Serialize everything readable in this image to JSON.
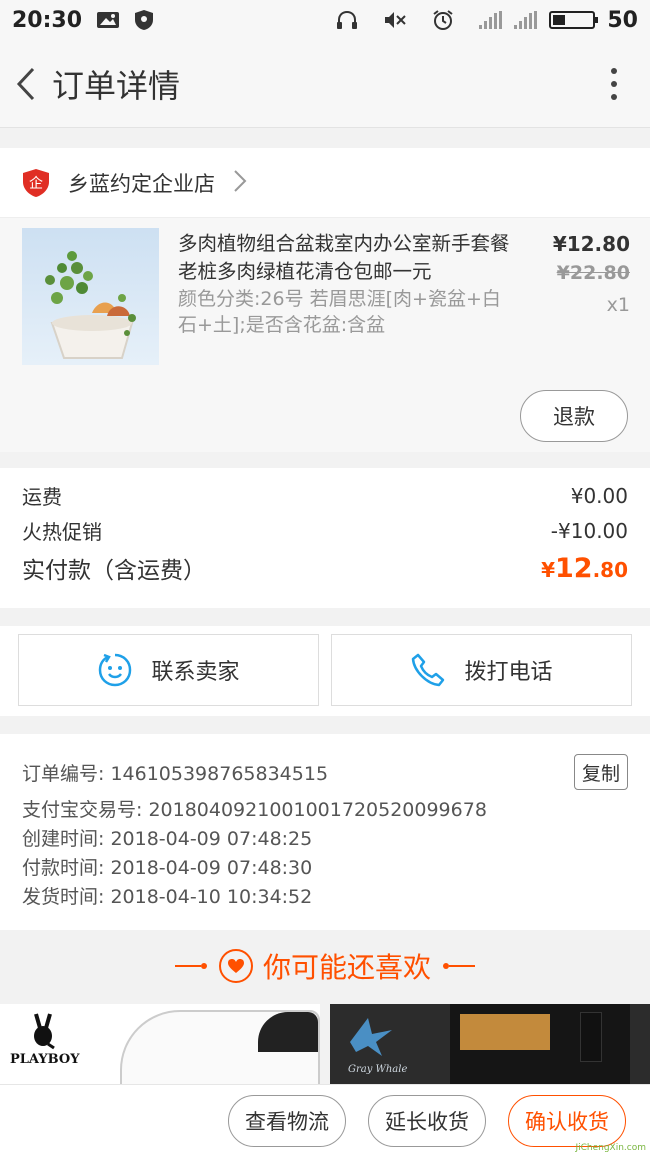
{
  "status_bar": {
    "time": "20:30",
    "battery_level": "50",
    "network": "4G",
    "icons": [
      "image-icon",
      "shield-icon",
      "headset-icon",
      "mute-icon",
      "alarm-icon",
      "signal-icon",
      "battery-icon"
    ]
  },
  "app_bar": {
    "title": "订单详情",
    "back_icon": "chevron-left-icon",
    "menu_icon": "more-vertical-icon"
  },
  "shop": {
    "badge_icon": "enterprise-shop-icon",
    "badge_text": "企",
    "name": "乡蓝约定企业店",
    "arrow_icon": "chevron-right-icon"
  },
  "product": {
    "title": "多肉植物组合盆栽室内办公室新手套餐老桩多肉绿植花清仓包邮一元",
    "spec": "颜色分类:26号 若眉思涯[肉+瓷盆+白石+土];是否含花盆:含盆",
    "price": "¥12.80",
    "original_price": "¥22.80",
    "quantity": "x1",
    "refund_label": "退款"
  },
  "fees": {
    "shipping_label": "运费",
    "shipping_value": "¥0.00",
    "promo_label": "火热促销",
    "promo_value": "-¥10.00",
    "total_label": "实付款（含运费）",
    "total_symbol": "¥",
    "total_int": "12",
    "total_dec": ".80",
    "accent_color": "#ff5000"
  },
  "contact": {
    "seller_label": "联系卖家",
    "seller_icon": "chat-smile-icon",
    "phone_label": "拨打电话",
    "phone_icon": "phone-icon"
  },
  "order_info": {
    "order_no": "订单编号: 146105398765834515",
    "copy_label": "复制",
    "alipay_no": "支付宝交易号: 2018040921001001720520099678",
    "created": "创建时间: 2018-04-09 07:48:25",
    "paid": "付款时间: 2018-04-09 07:48:30",
    "shipped": "发货时间: 2018-04-10 10:34:52"
  },
  "recommend": {
    "title": "你可能还喜欢",
    "heart_icon": "heart-icon",
    "items": [
      {
        "brand": "PLAYBOY"
      },
      {
        "brand": "Gray Whale"
      }
    ]
  },
  "bottom_bar": {
    "logistics_label": "查看物流",
    "extend_label": "延长收货",
    "confirm_label": "确认收货"
  },
  "watermark": "JiChengXin.com"
}
